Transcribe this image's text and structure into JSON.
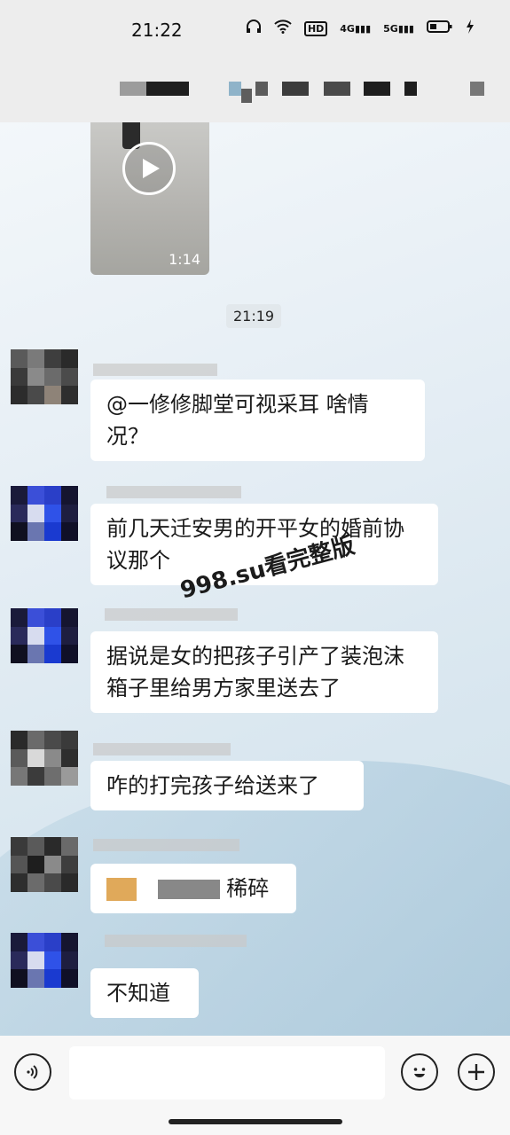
{
  "status_bar": {
    "time": "21:22",
    "icons": [
      "headphones-icon",
      "wifi-icon",
      "hd-icon",
      "signal-4g-icon",
      "signal-5g-icon",
      "battery-icon",
      "charging-icon"
    ],
    "hd_label": "HD",
    "net1": "4G",
    "net2": "5G"
  },
  "video": {
    "duration": "1:14"
  },
  "timestamp": "21:19",
  "messages": [
    {
      "text": "@一修修脚堂可视采耳  啥情况？"
    },
    {
      "text": "前几天迁安男的开平女的婚前协议那个"
    },
    {
      "text": "据说是女的把孩子引产了装泡沫箱子里给男方家里送去了"
    },
    {
      "text": "咋的打完孩子给送来了"
    },
    {
      "text": "稀碎"
    },
    {
      "text": "不知道"
    }
  ],
  "watermark": "998.su看完整版",
  "colors": {
    "bubble": "#ffffff",
    "chat_bg": "#e4edf4",
    "header_bg": "#ededed"
  }
}
